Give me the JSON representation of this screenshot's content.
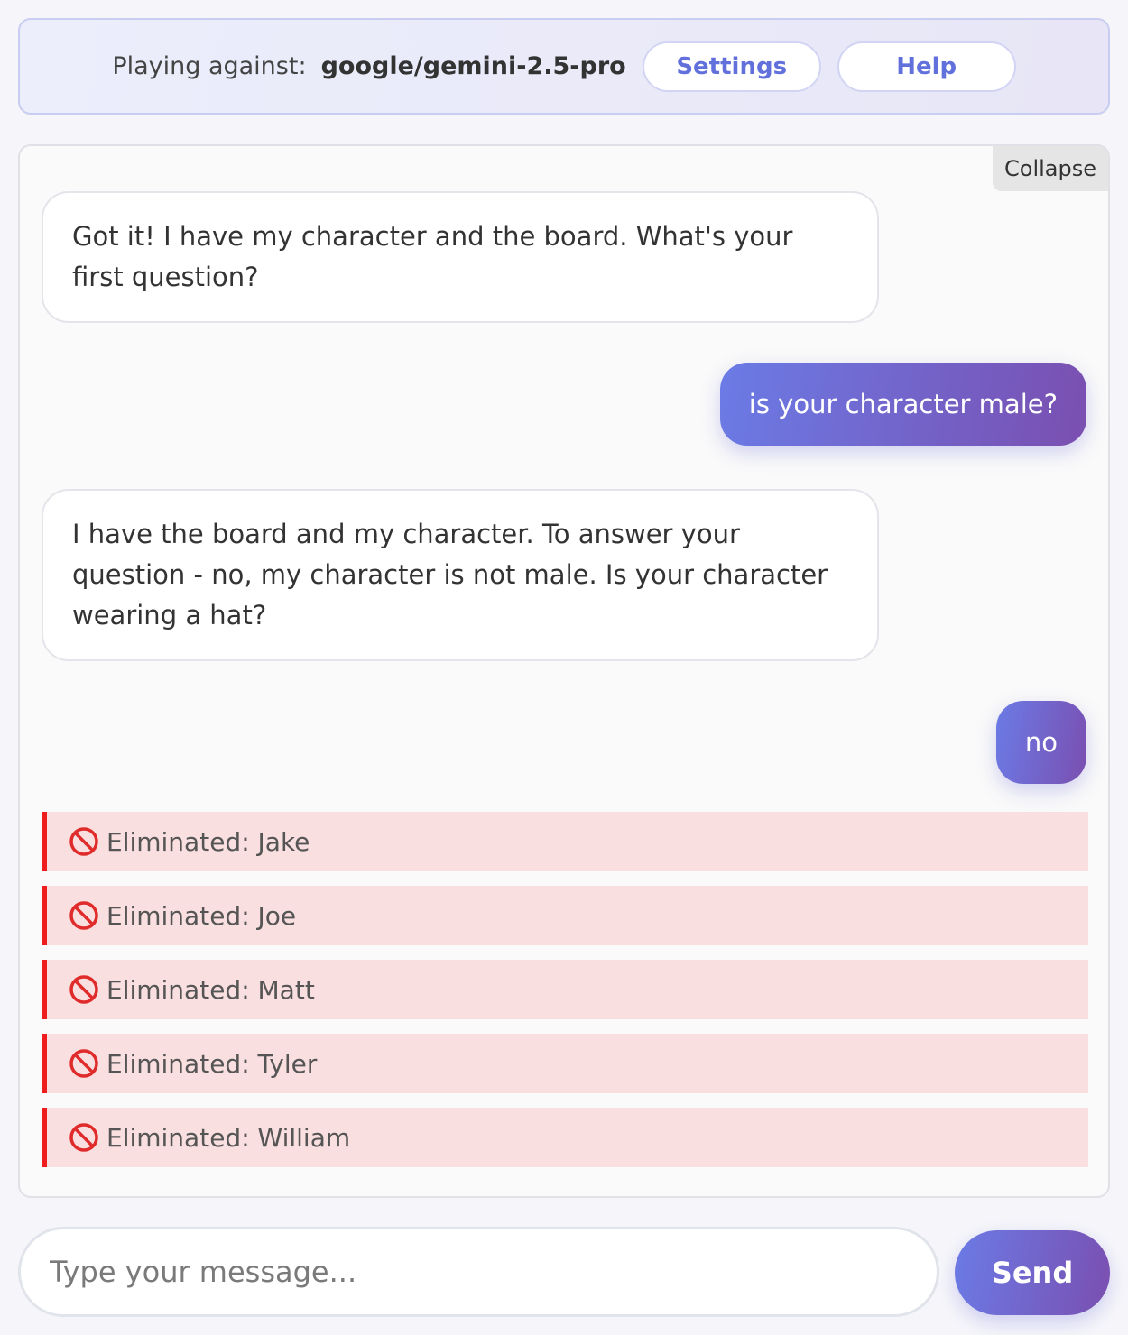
{
  "header": {
    "playing_label": "Playing against:",
    "model": "google/gemini-2.5-pro",
    "settings_label": "Settings",
    "help_label": "Help"
  },
  "chat": {
    "collapse_label": "Collapse",
    "messages": [
      {
        "role": "assistant",
        "text": "Got it! I have my character and the board. What's your first question?"
      },
      {
        "role": "user",
        "text": "is your character male?"
      },
      {
        "role": "assistant",
        "text": "I have the board and my character. To answer your question - no, my character is not male. Is your character wearing a hat?"
      },
      {
        "role": "user",
        "text": "no"
      }
    ],
    "eliminations": [
      {
        "icon": "ban-icon",
        "text": "Eliminated: Jake"
      },
      {
        "icon": "ban-icon",
        "text": "Eliminated: Joe"
      },
      {
        "icon": "ban-icon",
        "text": "Eliminated: Matt"
      },
      {
        "icon": "ban-icon",
        "text": "Eliminated: Tyler"
      },
      {
        "icon": "ban-icon",
        "text": "Eliminated: William"
      }
    ]
  },
  "composer": {
    "placeholder": "Type your message...",
    "send_label": "Send"
  },
  "colors": {
    "accent_start": "#6b7be6",
    "accent_end": "#7a4fb0",
    "elimination_bar": "#ee1c1c",
    "elimination_bg": "#fadfe0"
  }
}
